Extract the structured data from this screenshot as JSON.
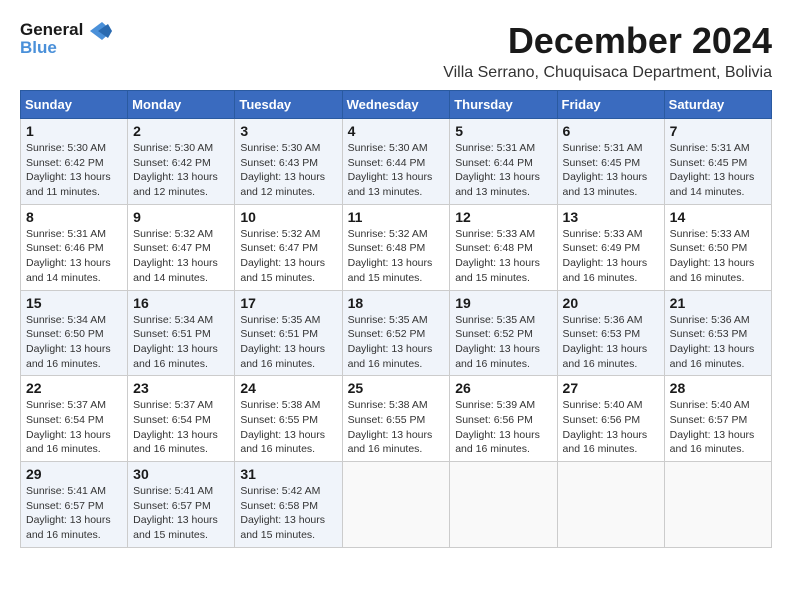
{
  "logo": {
    "line1": "General",
    "line2": "Blue"
  },
  "title": "December 2024",
  "subtitle": "Villa Serrano, Chuquisaca Department, Bolivia",
  "weekdays": [
    "Sunday",
    "Monday",
    "Tuesday",
    "Wednesday",
    "Thursday",
    "Friday",
    "Saturday"
  ],
  "weeks": [
    [
      {
        "day": 1,
        "sunrise": "5:30 AM",
        "sunset": "6:42 PM",
        "daylight": "13 hours and 11 minutes."
      },
      {
        "day": 2,
        "sunrise": "5:30 AM",
        "sunset": "6:42 PM",
        "daylight": "13 hours and 12 minutes."
      },
      {
        "day": 3,
        "sunrise": "5:30 AM",
        "sunset": "6:43 PM",
        "daylight": "13 hours and 12 minutes."
      },
      {
        "day": 4,
        "sunrise": "5:30 AM",
        "sunset": "6:44 PM",
        "daylight": "13 hours and 13 minutes."
      },
      {
        "day": 5,
        "sunrise": "5:31 AM",
        "sunset": "6:44 PM",
        "daylight": "13 hours and 13 minutes."
      },
      {
        "day": 6,
        "sunrise": "5:31 AM",
        "sunset": "6:45 PM",
        "daylight": "13 hours and 13 minutes."
      },
      {
        "day": 7,
        "sunrise": "5:31 AM",
        "sunset": "6:45 PM",
        "daylight": "13 hours and 14 minutes."
      }
    ],
    [
      {
        "day": 8,
        "sunrise": "5:31 AM",
        "sunset": "6:46 PM",
        "daylight": "13 hours and 14 minutes."
      },
      {
        "day": 9,
        "sunrise": "5:32 AM",
        "sunset": "6:47 PM",
        "daylight": "13 hours and 14 minutes."
      },
      {
        "day": 10,
        "sunrise": "5:32 AM",
        "sunset": "6:47 PM",
        "daylight": "13 hours and 15 minutes."
      },
      {
        "day": 11,
        "sunrise": "5:32 AM",
        "sunset": "6:48 PM",
        "daylight": "13 hours and 15 minutes."
      },
      {
        "day": 12,
        "sunrise": "5:33 AM",
        "sunset": "6:48 PM",
        "daylight": "13 hours and 15 minutes."
      },
      {
        "day": 13,
        "sunrise": "5:33 AM",
        "sunset": "6:49 PM",
        "daylight": "13 hours and 16 minutes."
      },
      {
        "day": 14,
        "sunrise": "5:33 AM",
        "sunset": "6:50 PM",
        "daylight": "13 hours and 16 minutes."
      }
    ],
    [
      {
        "day": 15,
        "sunrise": "5:34 AM",
        "sunset": "6:50 PM",
        "daylight": "13 hours and 16 minutes."
      },
      {
        "day": 16,
        "sunrise": "5:34 AM",
        "sunset": "6:51 PM",
        "daylight": "13 hours and 16 minutes."
      },
      {
        "day": 17,
        "sunrise": "5:35 AM",
        "sunset": "6:51 PM",
        "daylight": "13 hours and 16 minutes."
      },
      {
        "day": 18,
        "sunrise": "5:35 AM",
        "sunset": "6:52 PM",
        "daylight": "13 hours and 16 minutes."
      },
      {
        "day": 19,
        "sunrise": "5:35 AM",
        "sunset": "6:52 PM",
        "daylight": "13 hours and 16 minutes."
      },
      {
        "day": 20,
        "sunrise": "5:36 AM",
        "sunset": "6:53 PM",
        "daylight": "13 hours and 16 minutes."
      },
      {
        "day": 21,
        "sunrise": "5:36 AM",
        "sunset": "6:53 PM",
        "daylight": "13 hours and 16 minutes."
      }
    ],
    [
      {
        "day": 22,
        "sunrise": "5:37 AM",
        "sunset": "6:54 PM",
        "daylight": "13 hours and 16 minutes."
      },
      {
        "day": 23,
        "sunrise": "5:37 AM",
        "sunset": "6:54 PM",
        "daylight": "13 hours and 16 minutes."
      },
      {
        "day": 24,
        "sunrise": "5:38 AM",
        "sunset": "6:55 PM",
        "daylight": "13 hours and 16 minutes."
      },
      {
        "day": 25,
        "sunrise": "5:38 AM",
        "sunset": "6:55 PM",
        "daylight": "13 hours and 16 minutes."
      },
      {
        "day": 26,
        "sunrise": "5:39 AM",
        "sunset": "6:56 PM",
        "daylight": "13 hours and 16 minutes."
      },
      {
        "day": 27,
        "sunrise": "5:40 AM",
        "sunset": "6:56 PM",
        "daylight": "13 hours and 16 minutes."
      },
      {
        "day": 28,
        "sunrise": "5:40 AM",
        "sunset": "6:57 PM",
        "daylight": "13 hours and 16 minutes."
      }
    ],
    [
      {
        "day": 29,
        "sunrise": "5:41 AM",
        "sunset": "6:57 PM",
        "daylight": "13 hours and 16 minutes."
      },
      {
        "day": 30,
        "sunrise": "5:41 AM",
        "sunset": "6:57 PM",
        "daylight": "13 hours and 15 minutes."
      },
      {
        "day": 31,
        "sunrise": "5:42 AM",
        "sunset": "6:58 PM",
        "daylight": "13 hours and 15 minutes."
      },
      null,
      null,
      null,
      null
    ]
  ]
}
